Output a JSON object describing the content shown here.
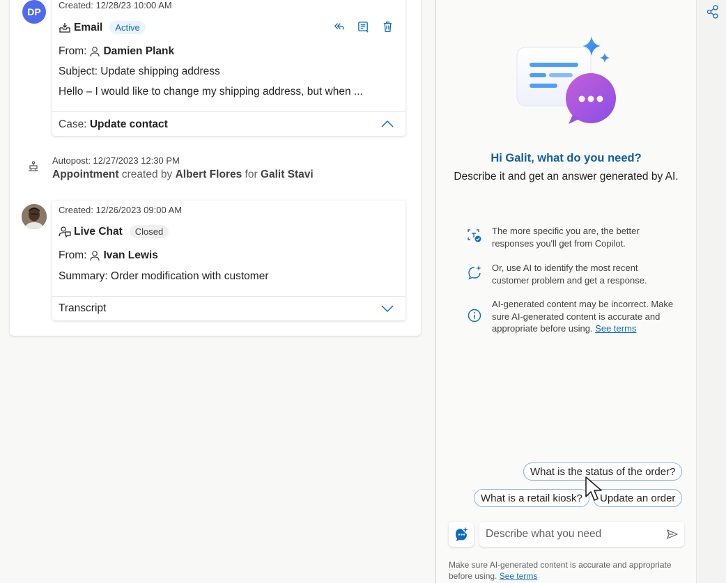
{
  "timeline": {
    "email_card": {
      "avatar_initials": "DP",
      "created": "Created: 12/28/23 10:00 AM",
      "type_label": "Email",
      "status": "Active",
      "from_label": "From:",
      "from_name": "Damien Plank",
      "subject": "Subject: Update shipping address",
      "preview": "Hello – I would like to change my shipping address, but when ...",
      "case_label": "Case:",
      "case_value": "Update contact"
    },
    "autopost": {
      "meta": "Autopost: 12/27/2023 12:30 PM",
      "entity": "Appointment",
      "created_by_text": "created by",
      "creator": "Albert Flores",
      "for_text": "for",
      "target": "Galit Stavi"
    },
    "chat_card": {
      "created": "Created: 12/26/2023 09:00 AM",
      "type_label": "Live Chat",
      "status": "Closed",
      "from_label": "From:",
      "from_name": "Ivan Lewis",
      "summary": "Summary: Order modification with customer",
      "transcript_label": "Transcript"
    }
  },
  "copilot": {
    "greeting": "Hi Galit, what do you need?",
    "subgreeting": "Describe it and get an answer generated by AI.",
    "tips": [
      {
        "icon": "scan-check-icon",
        "text": "The more specific you are, the better responses you'll get from Copilot."
      },
      {
        "icon": "chat-sparkle-icon",
        "text": "Or, use AI to identify the most recent customer problem and get a response."
      },
      {
        "icon": "info-icon",
        "text": "AI-generated content may be incorrect. Make sure AI-generated content is accurate and appropriate before using.",
        "link": "See terms"
      }
    ],
    "suggestions": [
      "What is the status of the order?",
      "What is a retail kiosk?",
      "Update an order"
    ],
    "input_placeholder": "Describe what you need",
    "disclaimer": "Make sure AI-generated content is accurate and appropriate before using.",
    "disclaimer_link": "See terms"
  },
  "colors": {
    "accent": "#0f6cbd",
    "avatar": "#4f6bed",
    "copilot_purple": "#9b4fe0"
  }
}
